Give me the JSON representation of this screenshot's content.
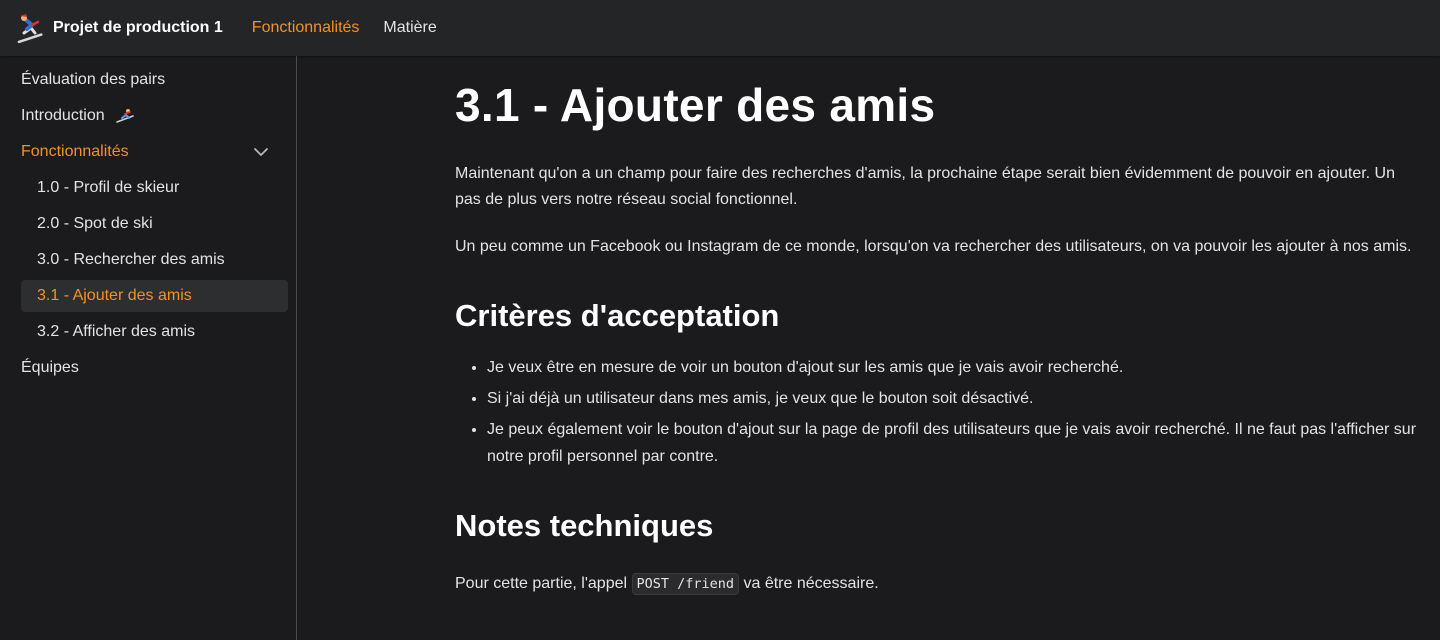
{
  "navbar": {
    "title": "Projet de production 1",
    "logo_icon": "skier-logo-icon",
    "links": [
      {
        "label": "Fonctionnalités",
        "active": true
      },
      {
        "label": "Matière",
        "active": false
      }
    ]
  },
  "sidebar": {
    "items": [
      {
        "label": "Évaluation des pairs"
      },
      {
        "label": "Introduction"
      },
      {
        "label": "Fonctionnalités",
        "expanded": true
      },
      {
        "label": "1.0 - Profil de skieur"
      },
      {
        "label": "2.0 - Spot de ski"
      },
      {
        "label": "3.0 - Rechercher des amis"
      },
      {
        "label": "3.1 - Ajouter des amis",
        "current": true
      },
      {
        "label": "3.2 - Afficher des amis"
      },
      {
        "label": "Équipes"
      }
    ]
  },
  "content": {
    "title": "3.1 - Ajouter des amis",
    "intro_p1": "Maintenant qu'on a un champ pour faire des recherches d'amis, la prochaine étape serait bien évidemment de pouvoir en ajouter. Un pas de plus vers notre réseau social fonctionnel.",
    "intro_p2": "Un peu comme un Facebook ou Instagram de ce monde, lorsqu'on va rechercher des utilisateurs, on va pouvoir les ajouter à nos amis.",
    "criteria_heading": "Critères d'acceptation",
    "criteria": [
      "Je veux être en mesure de voir un bouton d'ajout sur les amis que je vais avoir recherché.",
      "Si j'ai déjà un utilisateur dans mes amis, je veux que le bouton soit désactivé.",
      "Je peux également voir le bouton d'ajout sur la page de profil des utilisateurs que je vais avoir recherché. Il ne faut pas l'afficher sur notre profil personnel par contre."
    ],
    "notes_heading": "Notes techniques",
    "notes_before": "Pour cette partie, l'appel ",
    "notes_code": "POST /friend",
    "notes_after": " va être nécessaire."
  },
  "colors": {
    "accent": "#f59121",
    "background": "#1b1b1d",
    "navbar": "#242526",
    "text": "#e3e3e3"
  }
}
